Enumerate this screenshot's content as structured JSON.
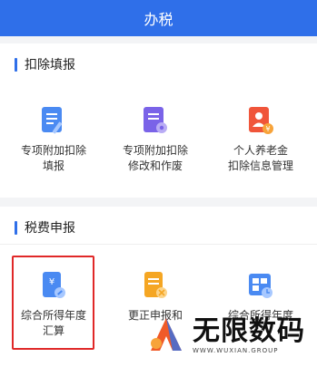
{
  "header": {
    "title": "办税"
  },
  "sections": [
    {
      "title": "扣除填报",
      "items": [
        {
          "line1": "专项附加扣除",
          "line2": "填报",
          "icon": "form-edit-icon",
          "color": "#4a8af2"
        },
        {
          "line1": "专项附加扣除",
          "line2": "修改和作废",
          "icon": "form-settings-icon",
          "color": "#7a63e8"
        },
        {
          "line1": "个人养老金",
          "line2": "扣除信息管理",
          "icon": "pension-icon",
          "color": "#f0553a"
        }
      ]
    },
    {
      "title": "税费申报",
      "items": [
        {
          "line1": "综合所得年度",
          "line2": "汇算",
          "icon": "annual-settlement-icon",
          "color": "#4a8af2"
        },
        {
          "line1": "更正申报和",
          "line2": "",
          "icon": "correction-icon",
          "color": "#f5a623"
        },
        {
          "line1": "综合所得年度",
          "line2": "",
          "icon": "calendar-report-icon",
          "color": "#4a8af2"
        }
      ]
    }
  ],
  "watermark": {
    "name": "无限数码",
    "url": "WWW.WUXIAN.GROUP"
  }
}
